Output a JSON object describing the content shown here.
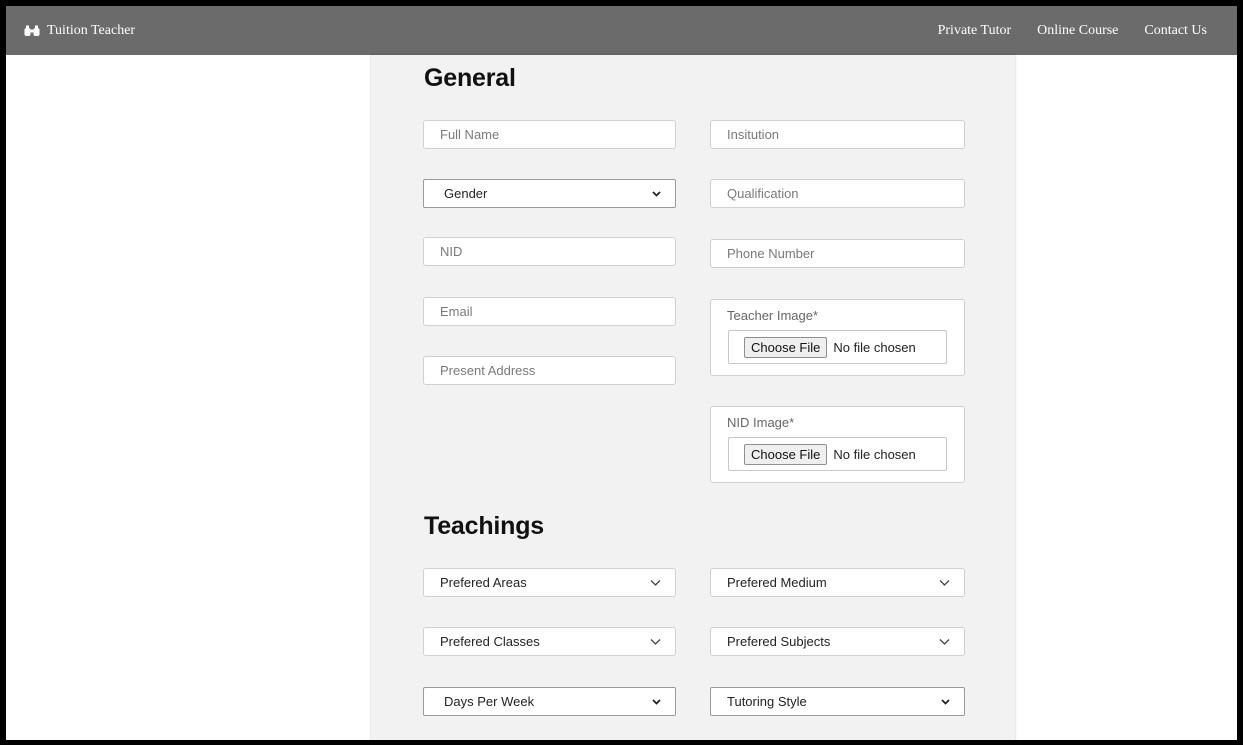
{
  "navbar": {
    "brand": "Tuition Teacher",
    "brand_icon": "binoculars-icon",
    "links": [
      "Private Tutor",
      "Online Course",
      "Contact Us"
    ]
  },
  "general": {
    "title": "General",
    "full_name_placeholder": "Full Name",
    "institution_placeholder": "Insitution",
    "gender_select": "Gender",
    "qualification_placeholder": "Qualification",
    "nid_placeholder": "NID",
    "phone_placeholder": "Phone Number",
    "email_placeholder": "Email",
    "present_address_placeholder": "Present Address",
    "teacher_image_label": "Teacher Image*",
    "nid_image_label": "NID Image*",
    "choose_file_label": "Choose File",
    "no_file_text": "No file chosen"
  },
  "teachings": {
    "title": "Teachings",
    "prefered_areas": "Prefered Areas",
    "prefered_medium": "Prefered Medium",
    "prefered_classes": "Prefered Classes",
    "prefered_subjects": "Prefered Subjects",
    "days_per_week": "Days Per Week",
    "tutoring_style": "Tutoring Style"
  },
  "colors": {
    "navbar_bg": "#6b6b6b",
    "form_bg": "#f2f2f2"
  }
}
